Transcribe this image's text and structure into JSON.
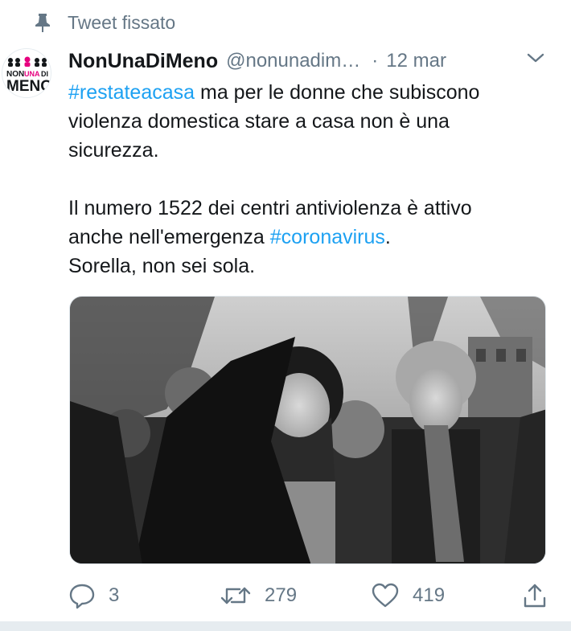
{
  "pinned": {
    "label": "Tweet fissato",
    "icon": "pin-icon"
  },
  "avatar": {
    "logo_lines": [
      "NON",
      "UNA",
      "DI",
      "MENO"
    ],
    "accent": "#e6007e"
  },
  "author": {
    "display_name": "NonUnaDiMeno",
    "handle": "@nonunadim…",
    "separator": "·",
    "time": "12 mar"
  },
  "tweet": {
    "line1_hashtag": "#restateacasa",
    "line1_text": " ma per le donne che subiscono",
    "line2": "violenza domestica stare a casa non è una",
    "line3": "sicurezza.",
    "line4": "Il numero 1522 dei centri antiviolenza è attivo",
    "line5_text": "anche nell'emergenza ",
    "line5_hashtag": "#coronavirus",
    "line5_end": ".",
    "line6": "Sorella, non sei sola."
  },
  "actions": {
    "reply_count": "3",
    "retweet_count": "279",
    "like_count": "419"
  },
  "colors": {
    "link": "#1da1f2",
    "secondary": "#657786",
    "text": "#14171a"
  }
}
